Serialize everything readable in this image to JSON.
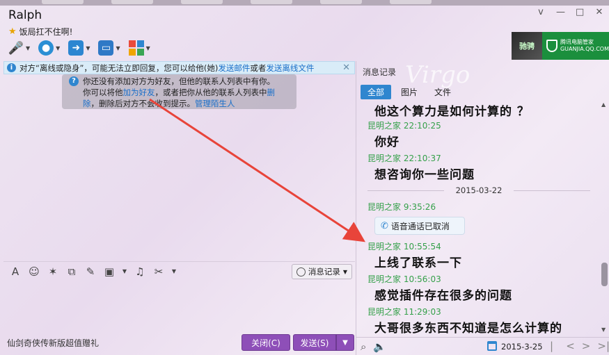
{
  "window": {
    "title": "Ralph",
    "status_text": "饭局扛不住啊!",
    "controls": [
      "v",
      "—",
      "□",
      "✕"
    ]
  },
  "brand": {
    "logo_text": "驰骋",
    "guard_name": "腾讯电脑管家",
    "guard_url": "GUANJIA.QQ.COM"
  },
  "notice": {
    "text1": "对方“离线或隐身”，可能无法立即回复，您可以给他(她)",
    "link1": "发送邮件",
    "text2": "或者",
    "link2": "发送离线文件"
  },
  "tip": {
    "line1": "你还没有添加对方为好友，但他的联系人列表中有你。",
    "line2a": "你可以将他",
    "link_add": "加为好友",
    "line2b": "，或者把你从他的联系人列表中",
    "link_del1": "删",
    "link_del2": "除",
    "line3": "，删除后对方不会收到提示。",
    "link_manage": "管理陌生人"
  },
  "input_toolbar": {
    "history_label": "消息记录"
  },
  "bottom": {
    "ad_text": "仙剑奇侠传新版超值赠礼",
    "close_label": "关闭(C)",
    "send_label": "发送(S)"
  },
  "history": {
    "title": "消息记录",
    "filters": [
      "全部",
      "图片",
      "文件"
    ],
    "date_sep": "2015-03-22",
    "messages": [
      {
        "text": "他这个算力是如何计算的 ？"
      },
      {
        "sender": "昆明之家 22:10:25",
        "text": "你好"
      },
      {
        "sender": "昆明之家 22:10:37",
        "text": "想咨询你一些问题"
      },
      {
        "sender": "昆明之家 9:35:26",
        "call": "语音通话已取消"
      },
      {
        "sender": "昆明之家 10:55:54",
        "text": "上线了联系一下"
      },
      {
        "sender": "昆明之家 10:56:03",
        "text": "感觉插件存在很多的问题"
      },
      {
        "sender": "昆明之家 11:29:03",
        "text": "大哥很多东西不知道是怎么计算的"
      }
    ],
    "footer_date": "2015-3-25"
  }
}
